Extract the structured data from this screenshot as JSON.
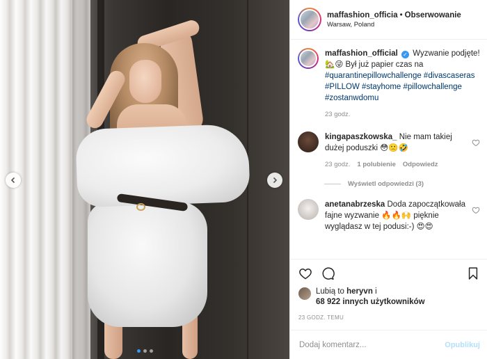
{
  "header": {
    "username": "maffashion_officia",
    "separator": "•",
    "follow_label": "Obserwowanie",
    "location": "Warsaw, Poland"
  },
  "caption": {
    "username": "maffashion_official",
    "text_before": "Wyzwanie podjęte! 🏡😜 Był już papier czas na",
    "hashtags": "#quarantinepillowchallenge #divascaseras #PILLOW #stayhome #pillowchallenge #zostanwdomu",
    "time": "23 godz."
  },
  "comments": [
    {
      "username": "kingapaszkowska_",
      "text": "Nie mam takiej dużej poduszki 😳🙁🤣",
      "time": "23 godz.",
      "likes_label": "1 polubienie",
      "reply_label": "Odpowiedz"
    },
    {
      "username": "anetanabrzeska",
      "text": "Doda zapoczątkowała fajne wyzwanie 🔥🔥🙌 pięknie wyglądasz w tej podusi:-) 😍😍"
    }
  ],
  "view_replies_label": "Wyświetl odpowiedzi (3)",
  "likes": {
    "line1": "Lubią to",
    "liker": "heryvn",
    "line1_end": "i",
    "count_line": "68 922 innych użytkowników"
  },
  "time_ago": "23 GODZ. TEMU",
  "add_comment": {
    "placeholder": "Dodaj komentarz...",
    "publish_label": "Opublikuj"
  },
  "carousel": {
    "dot_count": 3,
    "active_dot": 1
  }
}
